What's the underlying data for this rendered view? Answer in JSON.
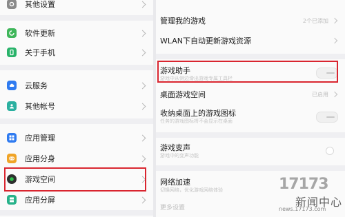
{
  "left_menu": {
    "items": [
      {
        "label": "其他设置",
        "icon": "settings-icon",
        "color": "#7a7a7a"
      },
      {
        "label": "软件更新",
        "icon": "update-icon",
        "color": "#3fb65a"
      },
      {
        "label": "关于手机",
        "icon": "phone-icon",
        "color": "#29b36a"
      },
      {
        "label": "云服务",
        "icon": "cloud-icon",
        "color": "#2f7bf0"
      },
      {
        "label": "其他帐号",
        "icon": "account-icon",
        "color": "#2bb0a0"
      },
      {
        "label": "应用管理",
        "icon": "apps-icon",
        "color": "#2f7bf0"
      },
      {
        "label": "应用分身",
        "icon": "clone-icon",
        "color": "#f0a427"
      },
      {
        "label": "游戏空间",
        "icon": "game-icon",
        "color": "#2e2e2e"
      },
      {
        "label": "应用分屏",
        "icon": "split-screen-icon",
        "color": "#27b28a"
      }
    ]
  },
  "right_settings": {
    "manage_games": {
      "title": "管理我的游戏",
      "value": "2个已添加"
    },
    "wlan_update": {
      "title": "WLAN下自动更新游戏资源"
    },
    "game_assistant": {
      "title": "游戏助手",
      "subtitle": "游戏中从侧边滑出游戏专属工具栏"
    },
    "desktop_space": {
      "title": "桌面游戏空间",
      "value": "已启用"
    },
    "collect_icons": {
      "title": "收纳桌面上的游戏图标",
      "subtitle": "任务的游戏图标将不会显示在桌面"
    },
    "voice_changer": {
      "title": "游戏变声",
      "subtitle": "游戏中的变声功能"
    },
    "network_boost": {
      "title": "网络加速",
      "subtitle": "切换网络，优化游戏网络体验"
    },
    "more": {
      "title": "更多设置"
    }
  },
  "watermark": {
    "logo": "17173",
    "name": "新闻中心",
    "url": "news.17173.com"
  },
  "colors": {
    "highlight": "#d9252f",
    "background": "#fafafa"
  }
}
